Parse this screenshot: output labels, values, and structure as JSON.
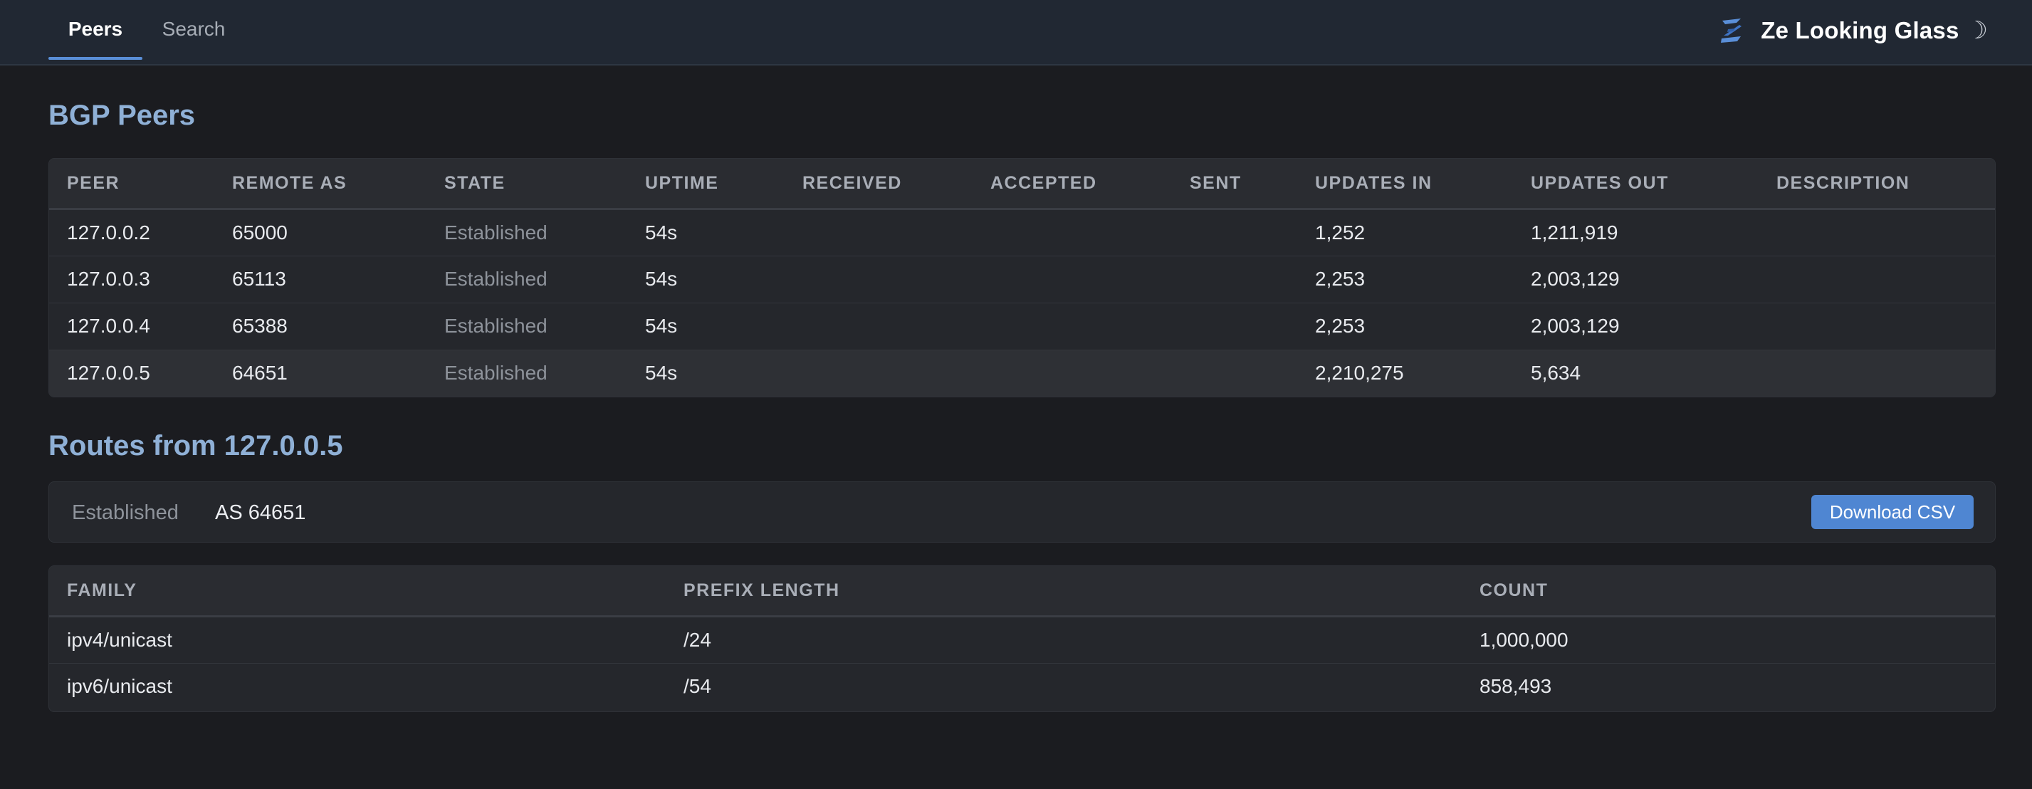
{
  "nav": {
    "tabs": [
      {
        "label": "Peers",
        "active": true
      },
      {
        "label": "Search",
        "active": false
      }
    ],
    "brand_title": "Ze Looking Glass",
    "theme_toggle_glyph": "☽",
    "logo_icon": "ze-logo-icon",
    "accent_color": "#5a8fd8"
  },
  "bgp": {
    "title": "BGP Peers",
    "columns": [
      "PEER",
      "REMOTE AS",
      "STATE",
      "UPTIME",
      "RECEIVED",
      "ACCEPTED",
      "SENT",
      "UPDATES IN",
      "UPDATES OUT",
      "DESCRIPTION"
    ],
    "rows": [
      {
        "peer": "127.0.0.2",
        "remote_as": "65000",
        "state": "Established",
        "uptime": "54s",
        "received": "",
        "accepted": "",
        "sent": "",
        "updates_in": "1,252",
        "updates_out": "1,211,919",
        "description": ""
      },
      {
        "peer": "127.0.0.3",
        "remote_as": "65113",
        "state": "Established",
        "uptime": "54s",
        "received": "",
        "accepted": "",
        "sent": "",
        "updates_in": "2,253",
        "updates_out": "2,003,129",
        "description": ""
      },
      {
        "peer": "127.0.0.4",
        "remote_as": "65388",
        "state": "Established",
        "uptime": "54s",
        "received": "",
        "accepted": "",
        "sent": "",
        "updates_in": "2,253",
        "updates_out": "2,003,129",
        "description": ""
      },
      {
        "peer": "127.0.0.5",
        "remote_as": "64651",
        "state": "Established",
        "uptime": "54s",
        "received": "",
        "accepted": "",
        "sent": "",
        "updates_in": "2,210,275",
        "updates_out": "5,634",
        "description": ""
      }
    ]
  },
  "routes": {
    "title": "Routes from 127.0.0.5",
    "summary": {
      "state": "Established",
      "as_label": "AS 64651",
      "download_label": "Download CSV"
    },
    "columns": [
      "FAMILY",
      "PREFIX LENGTH",
      "COUNT"
    ],
    "rows": [
      {
        "family": "ipv4/unicast",
        "prefix_length": "/24",
        "count": "1,000,000"
      },
      {
        "family": "ipv6/unicast",
        "prefix_length": "/54",
        "count": "858,493"
      }
    ]
  }
}
